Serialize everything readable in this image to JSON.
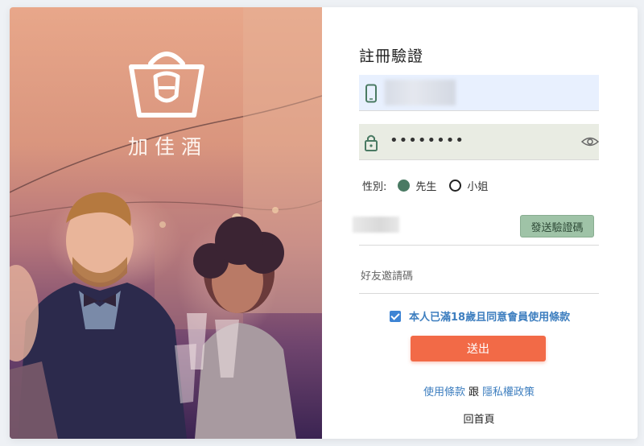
{
  "brand": {
    "name": "加佳酒",
    "logo_icon": "wine-bag-logo-icon"
  },
  "form": {
    "title": "註冊驗證",
    "phone": {
      "icon": "phone-icon",
      "value_obscured": true
    },
    "password": {
      "icon": "lock-icon",
      "masked_value": "••••••••",
      "toggle_icon": "eye-icon"
    },
    "gender": {
      "label": "性別:",
      "options": [
        {
          "label": "先生",
          "checked": true
        },
        {
          "label": "小姐",
          "checked": false
        }
      ]
    },
    "verification": {
      "value_obscured": true,
      "send_button": "發送驗證碼"
    },
    "invite": {
      "placeholder": "好友邀請碼"
    },
    "agreement": {
      "checked": true,
      "text": "本人已滿18歲且同意會員使用條款"
    },
    "submit": "送出",
    "terms_link": "使用條款",
    "and": "跟",
    "privacy_link": "隱私權政策",
    "home_link": "回首頁"
  },
  "colors": {
    "accent_green": "#4a7a63",
    "send_button": "#9fc3a7",
    "submit": "#f26a47",
    "link": "#3d7ebf",
    "autofill_bg": "#e8f0fe"
  }
}
